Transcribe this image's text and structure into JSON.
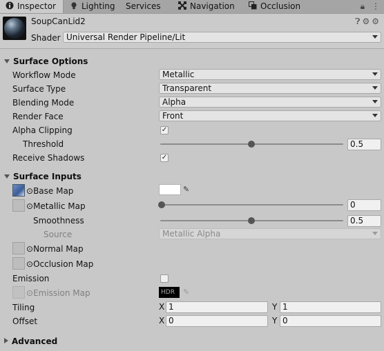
{
  "tabs": [
    {
      "label": "Inspector",
      "icon": "info-icon",
      "active": true
    },
    {
      "label": "Lighting",
      "icon": "bulb-icon",
      "active": false
    },
    {
      "label": "Services",
      "icon": "cloud-icon",
      "active": false
    },
    {
      "label": "Navigation",
      "icon": "navigation-icon",
      "active": false
    },
    {
      "label": "Occlusion",
      "icon": "occlusion-icon",
      "active": false
    }
  ],
  "header": {
    "material_name": "SoupCanLid2",
    "shader_label": "Shader",
    "shader_value": "Universal Render Pipeline/Lit"
  },
  "surface_options": {
    "title": "Surface Options",
    "workflow_label": "Workflow Mode",
    "workflow_value": "Metallic",
    "surface_type_label": "Surface Type",
    "surface_type_value": "Transparent",
    "blending_label": "Blending Mode",
    "blending_value": "Alpha",
    "render_face_label": "Render Face",
    "render_face_value": "Front",
    "alpha_clipping_label": "Alpha Clipping",
    "alpha_clipping_checked": true,
    "threshold_label": "Threshold",
    "threshold_value": "0.5",
    "receive_shadows_label": "Receive Shadows",
    "receive_shadows_checked": true
  },
  "surface_inputs": {
    "title": "Surface Inputs",
    "base_map_label": "Base Map",
    "metallic_map_label": "Metallic Map",
    "metallic_value": "0",
    "smoothness_label": "Smoothness",
    "smoothness_value": "0.5",
    "source_label": "Source",
    "source_value": "Metallic Alpha",
    "normal_map_label": "Normal Map",
    "occlusion_map_label": "Occlusion Map",
    "emission_label": "Emission",
    "emission_checked": false,
    "emission_map_label": "Emission Map",
    "hdr_label": "HDR",
    "tiling_label": "Tiling",
    "tiling_x": "1",
    "tiling_y": "1",
    "offset_label": "Offset",
    "offset_x": "0",
    "offset_y": "0",
    "x_label": "X",
    "y_label": "Y"
  },
  "advanced": {
    "title": "Advanced"
  },
  "checkmark": "✓"
}
